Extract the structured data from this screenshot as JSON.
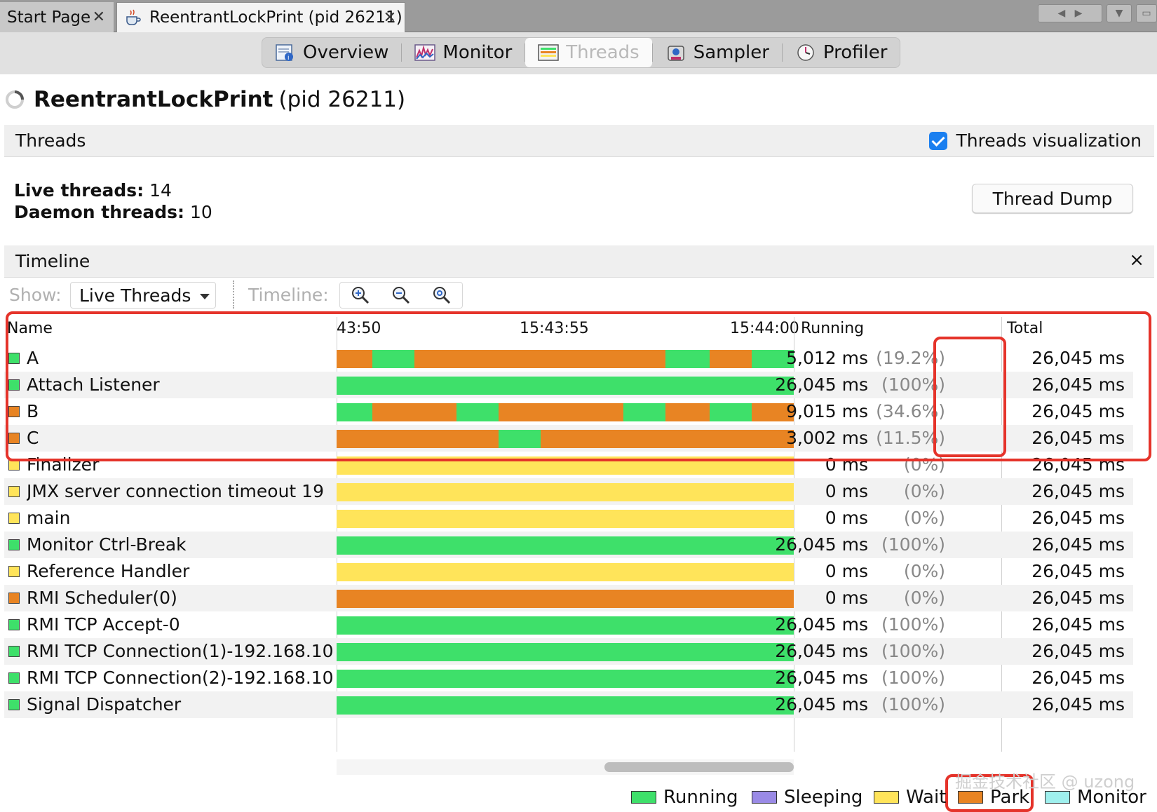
{
  "doc_tabs": [
    {
      "label": "Start Page",
      "active": false
    },
    {
      "label": "ReentrantLockPrint (pid 26211)",
      "active": true
    }
  ],
  "sub_tabs": [
    {
      "label": "Overview",
      "icon": "overview-icon"
    },
    {
      "label": "Monitor",
      "icon": "monitor-chart-icon"
    },
    {
      "label": "Threads",
      "icon": "threads-icon",
      "selected": true
    },
    {
      "label": "Sampler",
      "icon": "sampler-icon"
    },
    {
      "label": "Profiler",
      "icon": "profiler-clock-icon"
    }
  ],
  "app": {
    "name": "ReentrantLockPrint",
    "pid": "(pid 26211)"
  },
  "threads_section": {
    "title": "Threads",
    "viz_label": "Threads visualization",
    "viz_checked": true
  },
  "stats": {
    "live_label": "Live threads:",
    "live_value": "14",
    "daemon_label": "Daemon threads:",
    "daemon_value": "10"
  },
  "thread_dump_label": "Thread Dump",
  "timeline_section": {
    "title": "Timeline",
    "close": "×"
  },
  "toolbar": {
    "show_label": "Show:",
    "show_value": "Live Threads",
    "timeline_label": "Timeline:"
  },
  "columns": {
    "name": "Name",
    "running": "Running",
    "total": "Total"
  },
  "time_ticks": [
    "43:50",
    "15:43:55",
    "15:44:00"
  ],
  "colors": {
    "running": "#3ee06a",
    "sleeping": "#9a8ae6",
    "wait": "#ffe45a",
    "park": "#e88423",
    "monitor": "#9ff0ee",
    "highlight": "#e5332a"
  },
  "rows": [
    {
      "name": "A",
      "state": "running",
      "running": "5,012 ms",
      "pct": "(19.2%)",
      "total": "26,045 ms",
      "segments": [
        [
          "park",
          0,
          0.078
        ],
        [
          "running",
          0.078,
          0.17
        ],
        [
          "park",
          0.17,
          0.72
        ],
        [
          "running",
          0.72,
          0.816
        ],
        [
          "park",
          0.816,
          0.908
        ],
        [
          "running",
          0.908,
          1
        ]
      ]
    },
    {
      "name": "Attach Listener",
      "state": "running",
      "running": "26,045 ms",
      "pct": "(100%)",
      "total": "26,045 ms",
      "segments": [
        [
          "running",
          0,
          1
        ]
      ]
    },
    {
      "name": "B",
      "state": "park",
      "running": "9,015 ms",
      "pct": "(34.6%)",
      "total": "26,045 ms",
      "segments": [
        [
          "running",
          0,
          0.078
        ],
        [
          "park",
          0.078,
          0.262
        ],
        [
          "running",
          0.262,
          0.354
        ],
        [
          "park",
          0.354,
          0.628
        ],
        [
          "running",
          0.628,
          0.72
        ],
        [
          "park",
          0.72,
          0.816
        ],
        [
          "running",
          0.816,
          0.908
        ],
        [
          "park",
          0.908,
          1
        ]
      ]
    },
    {
      "name": "C",
      "state": "park",
      "running": "3,002 ms",
      "pct": "(11.5%)",
      "total": "26,045 ms",
      "segments": [
        [
          "park",
          0,
          0.354
        ],
        [
          "running",
          0.354,
          0.446
        ],
        [
          "park",
          0.446,
          1
        ]
      ]
    },
    {
      "name": "Finalizer",
      "state": "wait",
      "running": "0 ms",
      "pct": "(0%)",
      "total": "26,045 ms",
      "segments": [
        [
          "wait",
          0,
          1
        ]
      ]
    },
    {
      "name": "JMX server connection timeout 19",
      "state": "wait",
      "running": "0 ms",
      "pct": "(0%)",
      "total": "26,045 ms",
      "segments": [
        [
          "wait",
          0,
          1
        ]
      ]
    },
    {
      "name": "main",
      "state": "wait",
      "running": "0 ms",
      "pct": "(0%)",
      "total": "26,045 ms",
      "segments": [
        [
          "wait",
          0,
          1
        ]
      ]
    },
    {
      "name": "Monitor Ctrl-Break",
      "state": "running",
      "running": "26,045 ms",
      "pct": "(100%)",
      "total": "26,045 ms",
      "segments": [
        [
          "running",
          0,
          1
        ]
      ]
    },
    {
      "name": "Reference Handler",
      "state": "wait",
      "running": "0 ms",
      "pct": "(0%)",
      "total": "26,045 ms",
      "segments": [
        [
          "wait",
          0,
          1
        ]
      ]
    },
    {
      "name": "RMI Scheduler(0)",
      "state": "park",
      "running": "0 ms",
      "pct": "(0%)",
      "total": "26,045 ms",
      "segments": [
        [
          "park",
          0,
          1
        ]
      ]
    },
    {
      "name": "RMI TCP Accept-0",
      "state": "running",
      "running": "26,045 ms",
      "pct": "(100%)",
      "total": "26,045 ms",
      "segments": [
        [
          "running",
          0,
          1
        ]
      ]
    },
    {
      "name": "RMI TCP Connection(1)-192.168.10",
      "state": "running",
      "running": "26,045 ms",
      "pct": "(100%)",
      "total": "26,045 ms",
      "segments": [
        [
          "running",
          0,
          1
        ]
      ]
    },
    {
      "name": "RMI TCP Connection(2)-192.168.10",
      "state": "running",
      "running": "26,045 ms",
      "pct": "(100%)",
      "total": "26,045 ms",
      "segments": [
        [
          "running",
          0,
          1
        ]
      ]
    },
    {
      "name": "Signal Dispatcher",
      "state": "running",
      "running": "26,045 ms",
      "pct": "(100%)",
      "total": "26,045 ms",
      "segments": [
        [
          "running",
          0,
          1
        ]
      ]
    }
  ],
  "legend": [
    {
      "label": "Running",
      "state": "running"
    },
    {
      "label": "Sleeping",
      "state": "sleeping"
    },
    {
      "label": "Wait",
      "state": "wait"
    },
    {
      "label": "Park",
      "state": "park"
    },
    {
      "label": "Monitor",
      "state": "monitor"
    }
  ],
  "watermark": "掘金技术社区 @ uzong"
}
